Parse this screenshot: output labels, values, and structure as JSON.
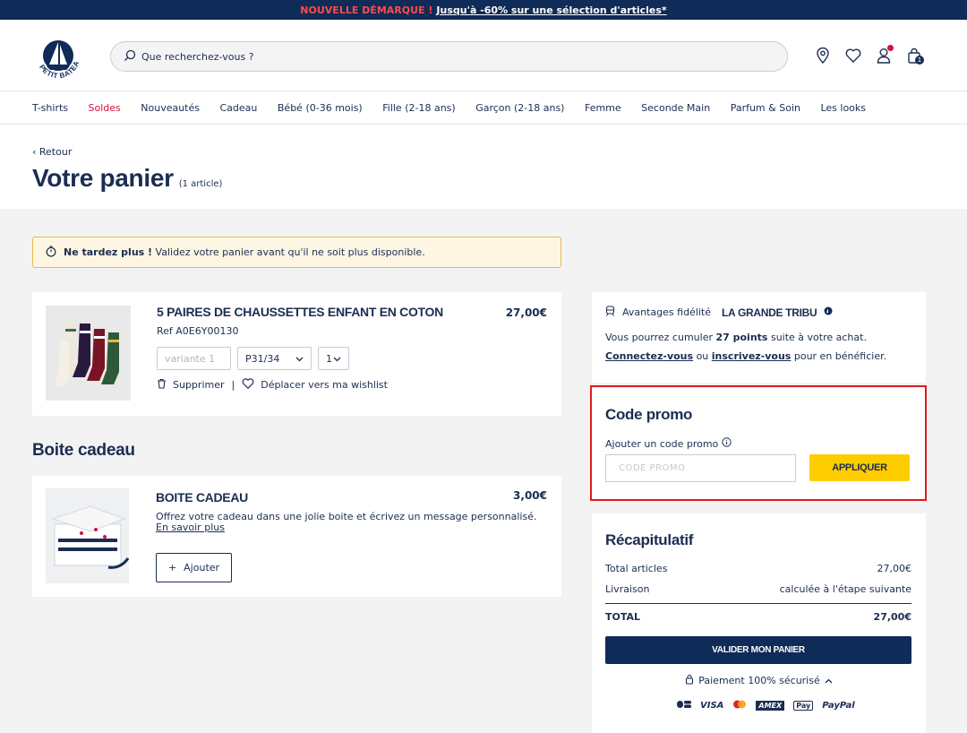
{
  "banner": {
    "prefix": "NOUVELLE DÉMARQUE !",
    "link": "Jusqu'à -60% sur une sélection d'articles*"
  },
  "header": {
    "search_placeholder": "Que recherchez-vous ?",
    "logo_text": "PETIT BATEAU",
    "bag_count": "1"
  },
  "nav": [
    "T-shirts",
    "Soldes",
    "Nouveautés",
    "Cadeau",
    "Bébé (0-36 mois)",
    "Fille (2-18 ans)",
    "Garçon (2-18 ans)",
    "Femme",
    "Seconde Main",
    "Parfum & Soin",
    "Les looks"
  ],
  "page": {
    "back": "‹ Retour",
    "title": "Votre panier",
    "count": "(1 article)"
  },
  "warning": {
    "bold": "Ne tardez plus !",
    "text": " Validez votre panier avant qu'il ne soit plus disponible."
  },
  "product": {
    "name": "5 PAIRES DE CHAUSSETTES ENFANT EN COTON",
    "ref": "Ref A0E6Y00130",
    "price": "27,00€",
    "variant_placeholder": "variante 1",
    "size": "P31/34",
    "qty": "1",
    "delete": "Supprimer",
    "wishlist": "Déplacer vers ma wishlist"
  },
  "gift": {
    "section_title": "Boite cadeau",
    "name": "BOITE CADEAU",
    "price": "3,00€",
    "desc": "Offrez votre cadeau dans une jolie boite et écrivez un message personnalisé.",
    "more": "En savoir plus",
    "add": "Ajouter"
  },
  "loyalty": {
    "label": "Avantages fidélité",
    "brand": "LA GRANDE TRIBU",
    "line1_pre": "Vous pourrez cumuler ",
    "points": "27 points",
    "line1_post": " suite à votre achat.",
    "connect": "Connectez-vous",
    "or": " ou ",
    "register": "inscrivez-vous",
    "line2_post": " pour en bénéficier."
  },
  "promo": {
    "title": "Code promo",
    "label": "Ajouter un code promo",
    "placeholder": "CODE PROMO",
    "apply": "APPLIQUER"
  },
  "summary": {
    "title": "Récapitulatif",
    "rows": [
      {
        "label": "Total articles",
        "value": "27,00€"
      },
      {
        "label": "Livraison",
        "value": "calculée à l'étape suivante"
      }
    ],
    "total_label": "TOTAL",
    "total_value": "27,00€",
    "validate": "VALIDER MON PANIER",
    "secure": "Paiement 100% sécurisé",
    "payments": [
      "CB",
      "VISA",
      "Mastercard",
      "AMEX",
      "Pay",
      "PayPal"
    ]
  },
  "colors": {
    "navy": "#0f2b57",
    "red": "#d4123a",
    "yellow": "#ffcc00"
  }
}
